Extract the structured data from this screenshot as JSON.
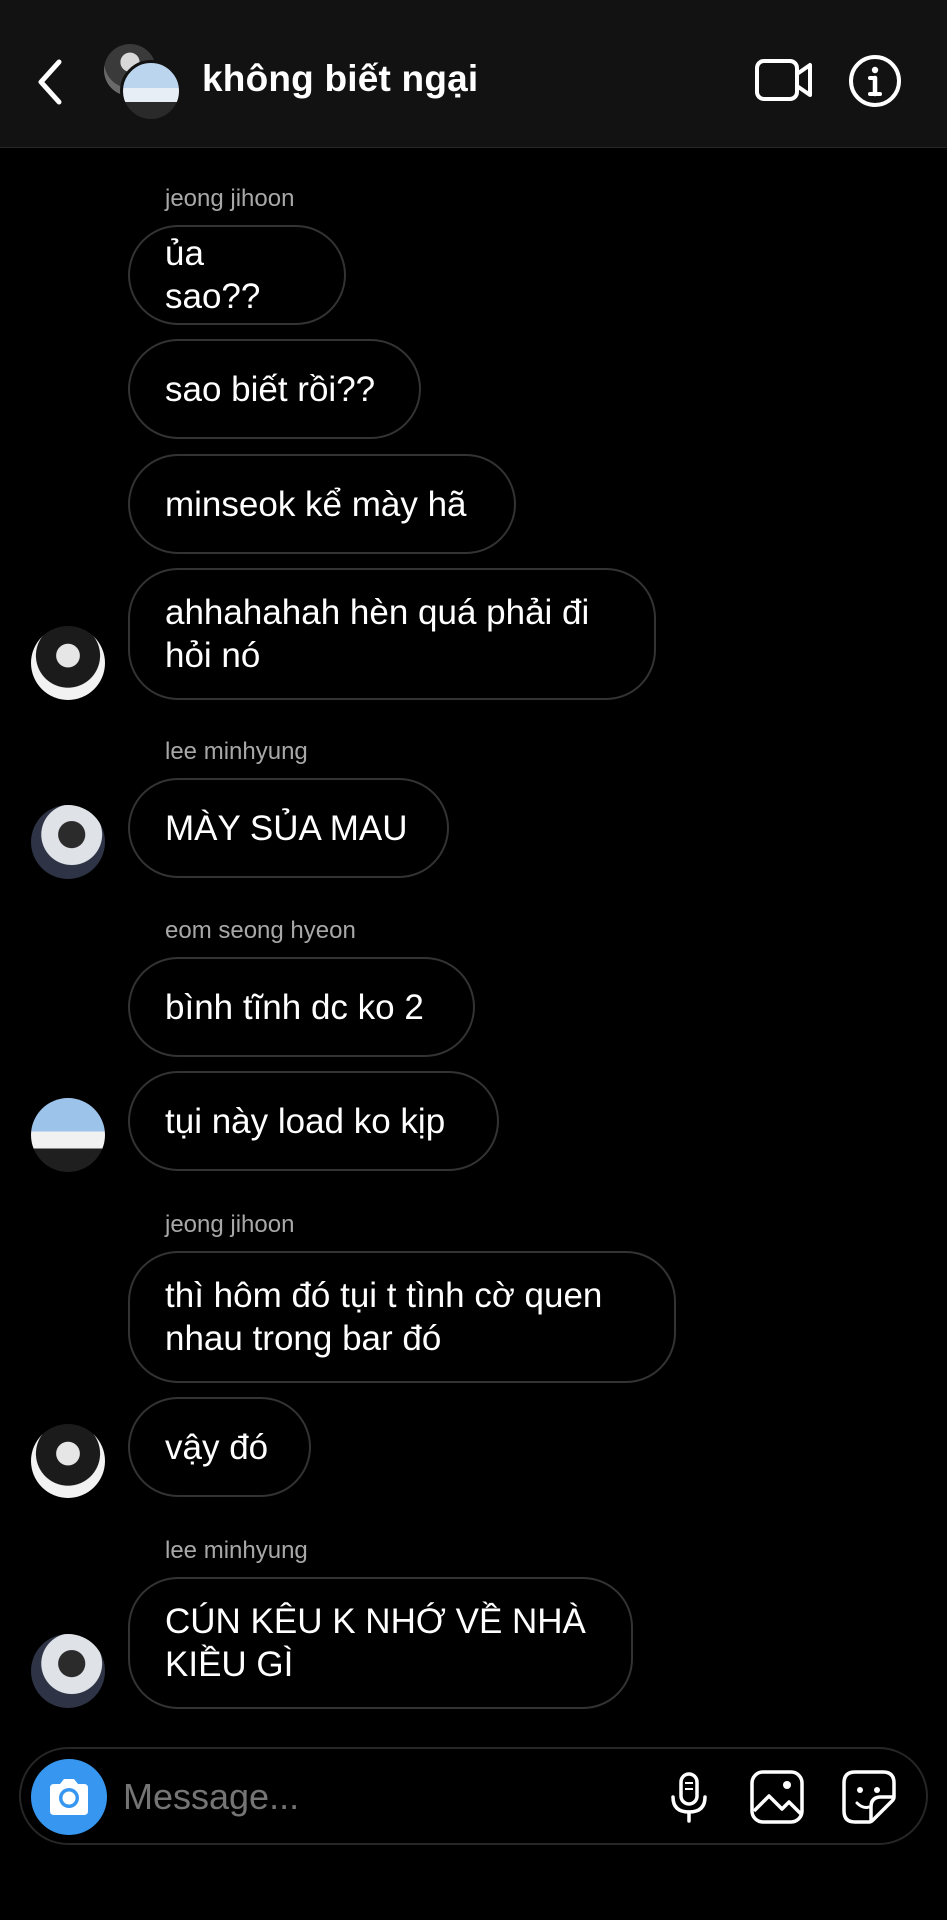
{
  "header": {
    "title": "không biết ngại",
    "icons": [
      "back-chevron-icon",
      "video-call-icon",
      "info-icon"
    ]
  },
  "messages": [
    {
      "sender": "jeong jihoon",
      "text": "ủa sao??"
    },
    {
      "text": "sao biết rồi??"
    },
    {
      "text": "minseok kể mày hã"
    },
    {
      "text": "ahhahahah hèn quá phải đi hỏi nó"
    },
    {
      "sender": "lee minhyung",
      "text": "MÀY SỦA MAU"
    },
    {
      "sender": "eom seong hyeon",
      "text": "bình tĩnh dc ko 2"
    },
    {
      "text": "tụi này load ko kịp"
    },
    {
      "sender": "jeong jihoon",
      "text": "thì hôm đó tụi t tình cờ quen nhau trong bar đó"
    },
    {
      "text": "vậy đó"
    },
    {
      "sender": "lee minhyung",
      "text": "CÚN KÊU K NHỚ VỀ NHÀ KIỀU GÌ"
    }
  ],
  "composer": {
    "placeholder": "Message...",
    "icons": [
      "camera-icon",
      "microphone-icon",
      "gallery-icon",
      "sticker-icon"
    ]
  },
  "colors": {
    "background": "#000000",
    "header_bg": "#121212",
    "bubble_border": "#333333",
    "sender_label": "#a8a8a8",
    "accent_blue": "#3797f0"
  }
}
